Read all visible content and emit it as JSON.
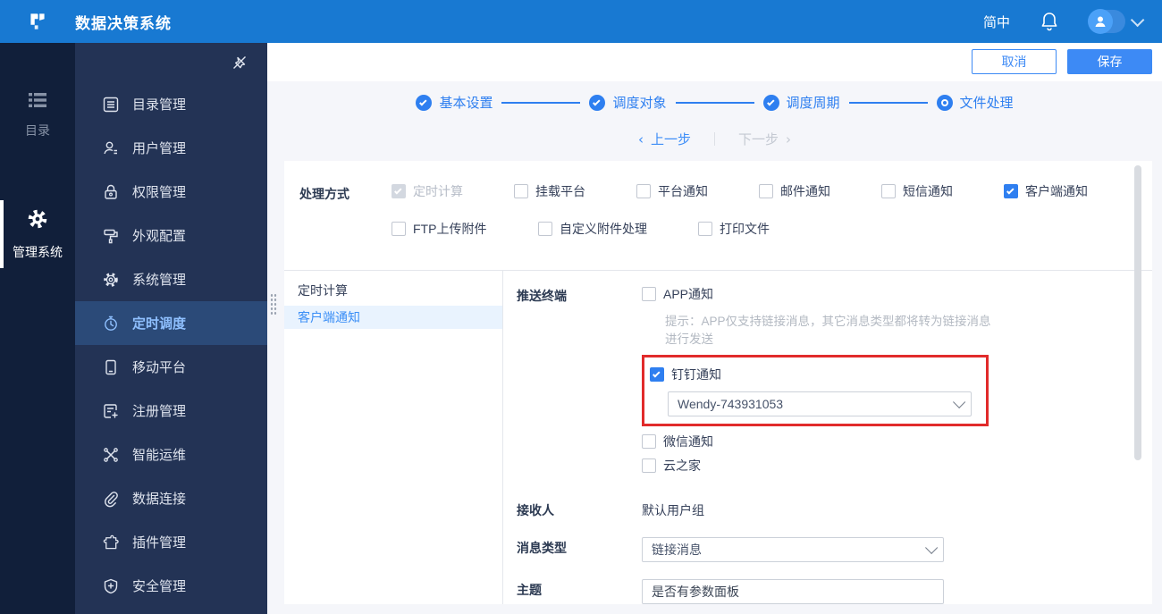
{
  "topbar": {
    "title": "数据决策系统",
    "language": "简中"
  },
  "primary_sidebar": {
    "items": [
      {
        "label": "目录",
        "icon": "list-icon",
        "active": false
      },
      {
        "label": "管理系统",
        "icon": "gear-icon",
        "active": true
      }
    ]
  },
  "secondary_sidebar": {
    "items": [
      {
        "label": "目录管理",
        "icon": "catalog-icon"
      },
      {
        "label": "用户管理",
        "icon": "user-icon"
      },
      {
        "label": "权限管理",
        "icon": "lock-icon"
      },
      {
        "label": "外观配置",
        "icon": "paint-roller-icon"
      },
      {
        "label": "系统管理",
        "icon": "gear-outline-icon"
      },
      {
        "label": "定时调度",
        "icon": "timer-icon",
        "active": true
      },
      {
        "label": "移动平台",
        "icon": "mobile-icon"
      },
      {
        "label": "注册管理",
        "icon": "register-icon"
      },
      {
        "label": "智能运维",
        "icon": "ops-icon"
      },
      {
        "label": "数据连接",
        "icon": "paperclip-icon"
      },
      {
        "label": "插件管理",
        "icon": "puzzle-icon"
      },
      {
        "label": "安全管理",
        "icon": "shield-icon"
      }
    ]
  },
  "toolbar": {
    "cancel_label": "取消",
    "save_label": "保存"
  },
  "stepper": {
    "steps": [
      {
        "label": "基本设置",
        "state": "done"
      },
      {
        "label": "调度对象",
        "state": "done"
      },
      {
        "label": "调度周期",
        "state": "done"
      },
      {
        "label": "文件处理",
        "state": "current"
      }
    ],
    "prev_label": "上一步",
    "next_label": "下一步"
  },
  "process_section": {
    "label": "处理方式",
    "row1": [
      {
        "label": "定时计算",
        "checked": true,
        "disabled": true
      },
      {
        "label": "挂载平台",
        "checked": false
      },
      {
        "label": "平台通知",
        "checked": false
      },
      {
        "label": "邮件通知",
        "checked": false
      },
      {
        "label": "短信通知",
        "checked": false
      },
      {
        "label": "客户端通知",
        "checked": true
      }
    ],
    "row2": [
      {
        "label": "FTP上传附件",
        "checked": false
      },
      {
        "label": "自定义附件处理",
        "checked": false
      },
      {
        "label": "打印文件",
        "checked": false
      }
    ]
  },
  "subtabs": {
    "items": [
      {
        "label": "定时计算",
        "active": false
      },
      {
        "label": "客户端通知",
        "active": true
      }
    ]
  },
  "client_notify": {
    "push_label": "推送终端",
    "app_label": "APP通知",
    "hint": "提示：APP仅支持链接消息，其它消息类型都将转为链接消息进行发送",
    "dingtalk_label": "钉钉通知",
    "dingtalk_account": "Wendy-743931053",
    "wechat_label": "微信通知",
    "yunzhijia_label": "云之家",
    "receiver_label": "接收人",
    "receiver_value": "默认用户组",
    "msg_type_label": "消息类型",
    "msg_type_value": "链接消息",
    "subject_label": "主题",
    "subject_value": "是否有参数面板"
  },
  "colors": {
    "topbar_blue": "#1879d2",
    "sidebar_dark": "#111f3a",
    "sidebar_navy": "#233355",
    "active_item_bg": "#2b4a78",
    "accent_blue": "#3d8af5",
    "checkbox_blue": "#2f7ff0",
    "annotation_red": "#e12b2b",
    "selected_tab_bg": "#e9f3fe"
  }
}
